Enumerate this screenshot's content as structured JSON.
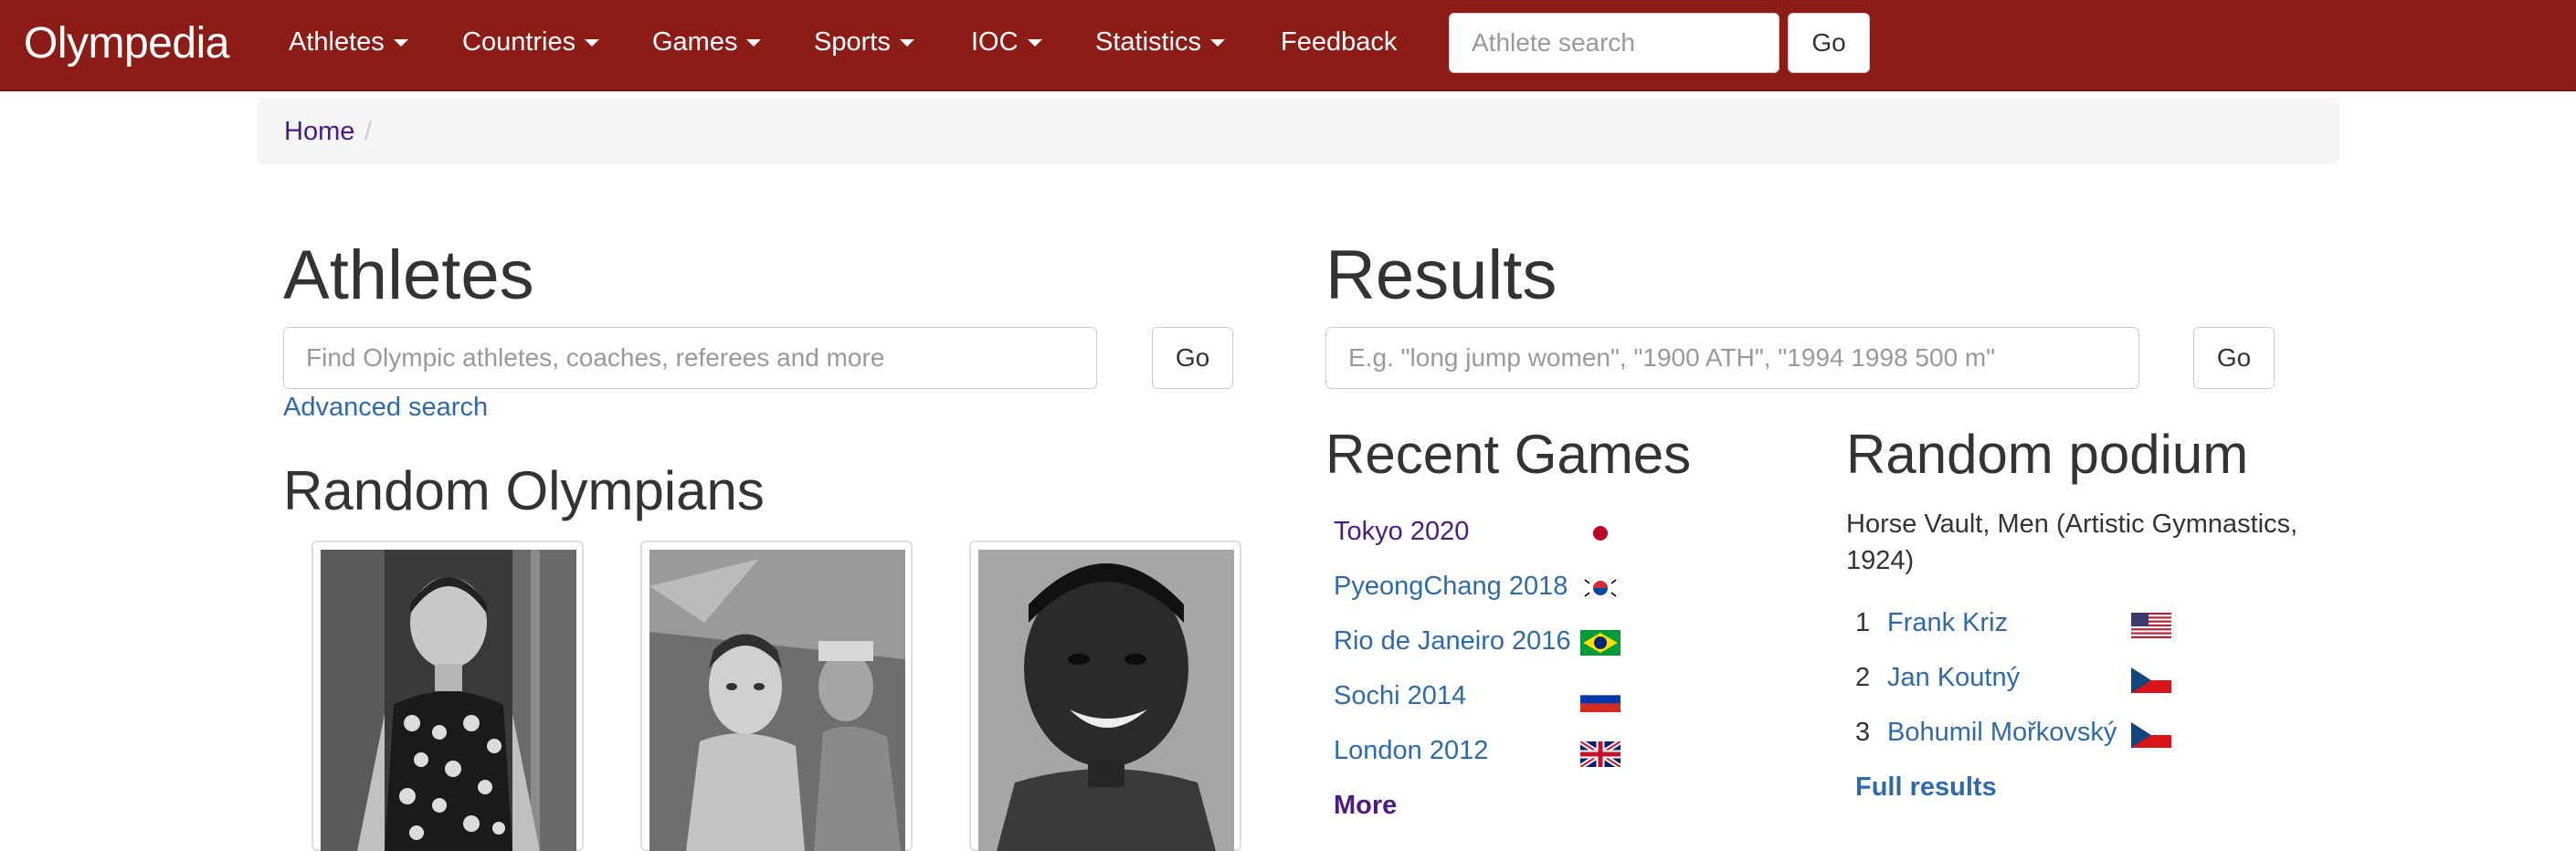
{
  "navbar": {
    "brand": "Olympedia",
    "items": [
      {
        "label": "Athletes"
      },
      {
        "label": "Countries"
      },
      {
        "label": "Games"
      },
      {
        "label": "Sports"
      },
      {
        "label": "IOC"
      },
      {
        "label": "Statistics"
      },
      {
        "label": "Feedback"
      }
    ],
    "search_placeholder": "Athlete search",
    "go_label": "Go"
  },
  "breadcrumb": {
    "home": "Home",
    "separator": "/"
  },
  "athletes": {
    "title": "Athletes",
    "search_placeholder": "Find Olympic athletes, coaches, referees and more",
    "go_label": "Go",
    "advanced_search": "Advanced search"
  },
  "random_olympians": {
    "title": "Random Olympians"
  },
  "results": {
    "title": "Results",
    "search_placeholder": "E.g. \"long jump women\", \"1900 ATH\", \"1994 1998 500 m\"",
    "go_label": "Go"
  },
  "recent_games": {
    "title": "Recent Games",
    "items": [
      {
        "label": "Tokyo 2020",
        "flag": "japan-flag-icon"
      },
      {
        "label": "PyeongChang 2018",
        "flag": "south-korea-flag-icon"
      },
      {
        "label": "Rio de Janeiro 2016",
        "flag": "brazil-flag-icon"
      },
      {
        "label": "Sochi 2014",
        "flag": "russia-flag-icon"
      },
      {
        "label": "London 2012",
        "flag": "united-kingdom-flag-icon"
      }
    ],
    "more": "More"
  },
  "random_podium": {
    "title": "Random podium",
    "event": "Horse Vault, Men (Artistic Gymnastics, 1924)",
    "places": [
      {
        "rank": "1",
        "name": "Frank Kriz",
        "flag": "usa-flag-icon"
      },
      {
        "rank": "2",
        "name": "Jan Koutný",
        "flag": "czech-flag-icon"
      },
      {
        "rank": "3",
        "name": "Bohumil Mořkovský",
        "flag": "czech-flag-icon"
      }
    ],
    "full_results": "Full results"
  },
  "colors": {
    "navbar": "#8c1c16",
    "link": "#2f6aa8",
    "visited_link": "#4b1b80",
    "breadcrumb_bg": "#f5f5f5"
  }
}
